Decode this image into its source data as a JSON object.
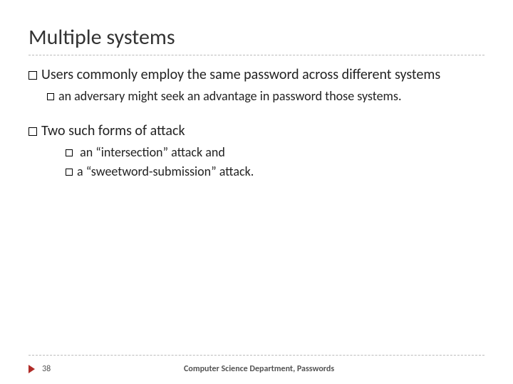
{
  "title": "Multiple systems",
  "bullets": {
    "b1": "Users commonly employ the same password across different systems",
    "b1_1": "an adversary might seek an advantage in password those systems.",
    "b2": "Two such forms of attack",
    "b2_1": " an “intersection” attack and",
    "b2_2": "a “sweetword-submission” attack."
  },
  "footer": {
    "page": "38",
    "center": "Computer Science Department, Passwords"
  }
}
